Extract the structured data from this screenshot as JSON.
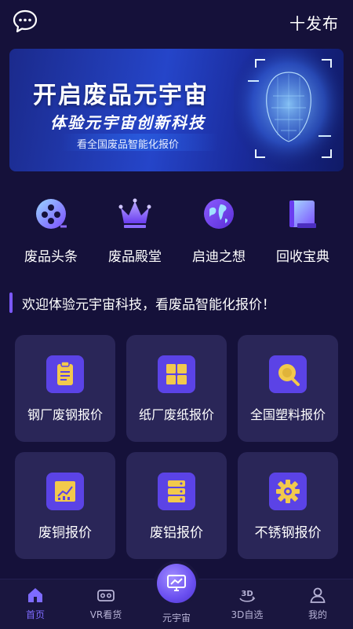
{
  "header": {
    "chat_icon": "chat-bubble-icon",
    "publish_label": "十发布"
  },
  "banner": {
    "title": "开启废品元宇宙",
    "subtitle": "体验元宇宙创新科技",
    "caption": "看全国废品智能化报价",
    "art_icon": "face-scan-icon"
  },
  "quick_links": [
    {
      "label": "废品头条",
      "icon": "film-reel-icon"
    },
    {
      "label": "废品殿堂",
      "icon": "crown-icon"
    },
    {
      "label": "启迪之想",
      "icon": "globe-icon"
    },
    {
      "label": "回收宝典",
      "icon": "book-icon"
    }
  ],
  "welcome_text": "欢迎体验元宇宙科技，看废品智能化报价！",
  "price_cards": [
    {
      "label": "钢厂废钢报价",
      "icon": "clipboard-icon"
    },
    {
      "label": "纸厂废纸报价",
      "icon": "grid-icon"
    },
    {
      "label": "全国塑料报价",
      "icon": "search-icon"
    },
    {
      "label": "废铜报价",
      "icon": "chart-icon"
    },
    {
      "label": "废铝报价",
      "icon": "database-icon"
    },
    {
      "label": "不锈钢报价",
      "icon": "gear-icon"
    }
  ],
  "tabbar": {
    "items": [
      {
        "label": "首页",
        "icon": "home-icon",
        "active": true
      },
      {
        "label": "VR看货",
        "icon": "vr-headset-icon",
        "active": false
      },
      {
        "label": "元宇宙",
        "icon": "monitor-chart-icon",
        "active": false
      },
      {
        "label": "3D自选",
        "icon": "3d-rotate-icon",
        "active": false
      },
      {
        "label": "我的",
        "icon": "user-icon",
        "active": false
      }
    ]
  },
  "colors": {
    "background": "#15113a",
    "card": "#2a2658",
    "accent": "#7b58ff",
    "icon_tile": "#5b43e6",
    "icon_gold": "#f2c94c"
  }
}
